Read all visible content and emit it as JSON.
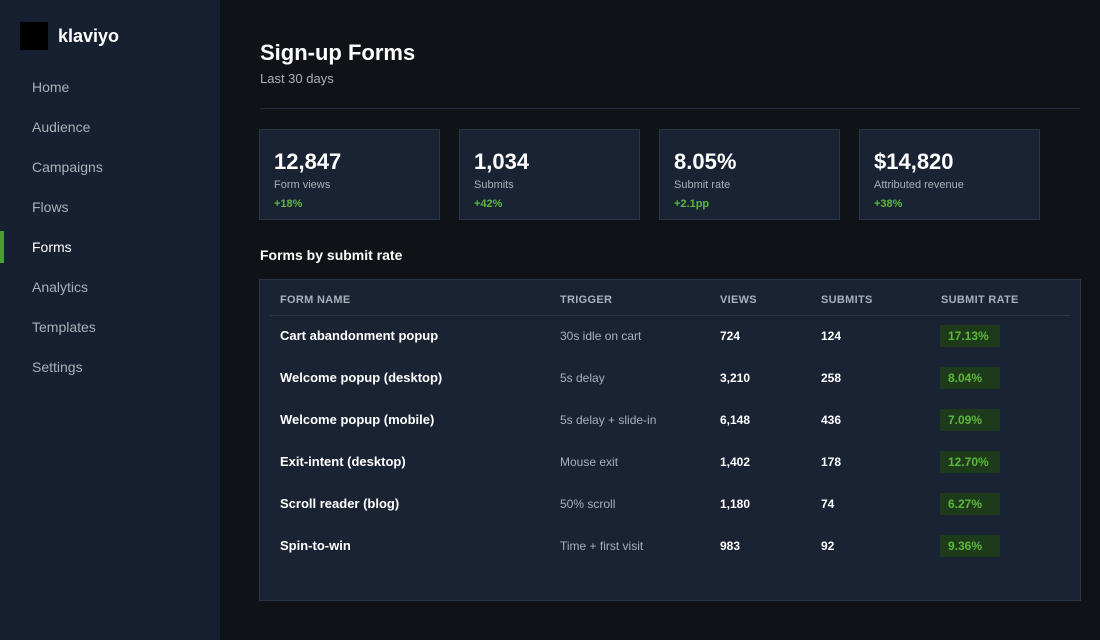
{
  "brand": {
    "name": "klaviyo"
  },
  "nav": {
    "items": [
      {
        "label": "Home",
        "active": false
      },
      {
        "label": "Audience",
        "active": false
      },
      {
        "label": "Campaigns",
        "active": false
      },
      {
        "label": "Flows",
        "active": false
      },
      {
        "label": "Forms",
        "active": true
      },
      {
        "label": "Analytics",
        "active": false
      },
      {
        "label": "Templates",
        "active": false
      },
      {
        "label": "Settings",
        "active": false
      }
    ]
  },
  "header": {
    "title": "Sign-up Forms",
    "subtitle": "Last 30 days"
  },
  "stats": [
    {
      "value": "12,847",
      "label": "Form views",
      "delta": "+18%"
    },
    {
      "value": "1,034",
      "label": "Submits",
      "delta": "+42%"
    },
    {
      "value": "8.05%",
      "label": "Submit rate",
      "delta": "+2.1pp"
    },
    {
      "value": "$14,820",
      "label": "Attributed revenue",
      "delta": "+38%"
    }
  ],
  "table": {
    "title": "Forms by submit rate",
    "columns": [
      "FORM NAME",
      "TRIGGER",
      "VIEWS",
      "SUBMITS",
      "SUBMIT RATE"
    ],
    "rows": [
      {
        "name": "Cart abandonment popup",
        "trigger": "30s idle on cart",
        "views": "724",
        "submits": "124",
        "rate": "17.13%"
      },
      {
        "name": "Welcome popup (desktop)",
        "trigger": "5s delay",
        "views": "3,210",
        "submits": "258",
        "rate": "8.04%"
      },
      {
        "name": "Welcome popup (mobile)",
        "trigger": "5s delay + slide-in",
        "views": "6,148",
        "submits": "436",
        "rate": "7.09%"
      },
      {
        "name": "Exit-intent (desktop)",
        "trigger": "Mouse exit",
        "views": "1,402",
        "submits": "178",
        "rate": "12.70%"
      },
      {
        "name": "Scroll reader (blog)",
        "trigger": "50% scroll",
        "views": "1,180",
        "submits": "74",
        "rate": "6.27%"
      },
      {
        "name": "Spin-to-win",
        "trigger": "Time + first visit",
        "views": "983",
        "submits": "92",
        "rate": "9.36%"
      }
    ]
  },
  "colors": {
    "sidebar_bg": "#172030",
    "page_bg": "#0f1318",
    "card_bg": "#1a2333",
    "accent_green": "#5cb83a",
    "active_indicator": "#4aa02c",
    "badge_bg": "#1d3a1a"
  }
}
